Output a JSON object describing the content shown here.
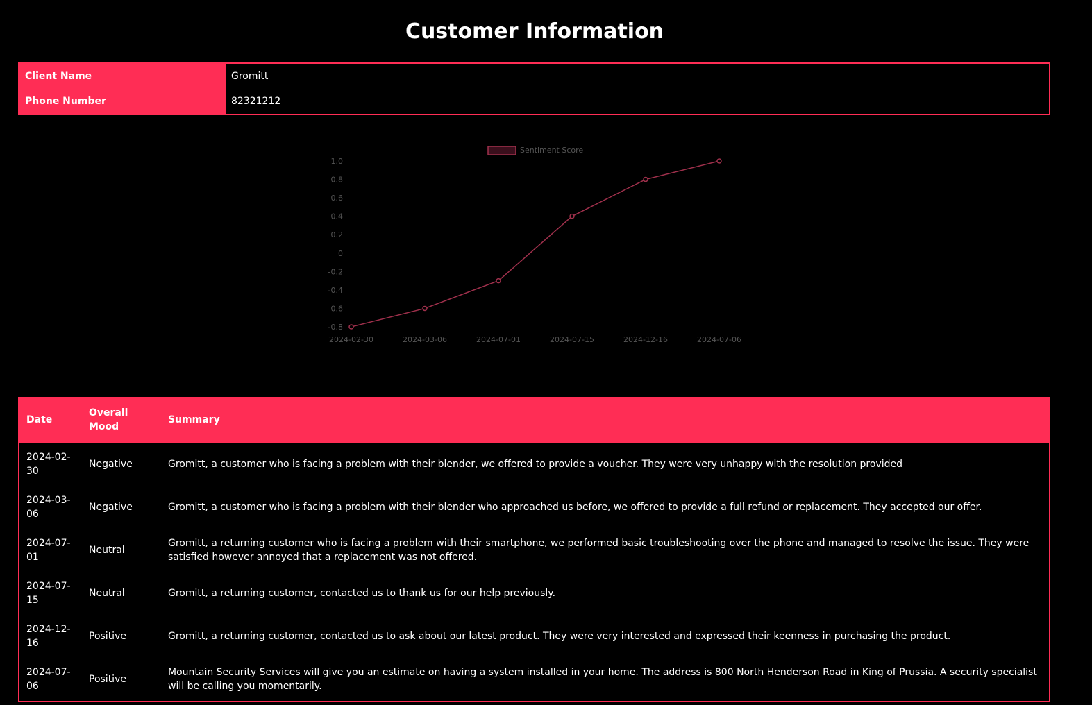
{
  "page": {
    "title": "Customer Information"
  },
  "customer": {
    "name_label": "Client Name",
    "name_value": "Gromitt",
    "phone_label": "Phone Number",
    "phone_value": "82321212"
  },
  "colors": {
    "accent": "#ff2d55",
    "line": "#a0304c",
    "axis_text": "#555555"
  },
  "chart_data": {
    "type": "line",
    "title": "",
    "xlabel": "",
    "ylabel": "",
    "categories": [
      "2024-02-30",
      "2024-03-06",
      "2024-07-01",
      "2024-07-15",
      "2024-12-16",
      "2024-07-06"
    ],
    "series": [
      {
        "name": "Sentiment Score",
        "values": [
          -0.8,
          -0.6,
          -0.3,
          0.4,
          0.8,
          1.0
        ]
      }
    ],
    "ylim": [
      -0.8,
      1.0
    ],
    "yticks": [
      "1.0",
      "0.8",
      "0.6",
      "0.4",
      "0.2",
      "0",
      "-0.2",
      "-0.4",
      "-0.6",
      "-0.8"
    ],
    "grid": false,
    "legend": "top"
  },
  "table": {
    "headers": {
      "date": "Date",
      "mood": "Overall Mood",
      "summary": "Summary"
    },
    "rows": [
      {
        "date": "2024-02-30",
        "mood": "Negative",
        "summary": "Gromitt, a customer who is facing a problem with their blender, we offered to provide a voucher. They were very unhappy with the resolution provided"
      },
      {
        "date": "2024-03-06",
        "mood": "Negative",
        "summary": "Gromitt, a customer who is facing a problem with their blender who approached us before, we offered to provide a full refund or replacement. They accepted our offer."
      },
      {
        "date": "2024-07-01",
        "mood": "Neutral",
        "summary": "Gromitt, a returning customer who is facing a problem with their smartphone, we performed basic troubleshooting over the phone and managed to resolve the issue. They were satisfied however annoyed that a replacement was not offered."
      },
      {
        "date": "2024-07-15",
        "mood": "Neutral",
        "summary": "Gromitt, a returning customer, contacted us to thank us for our help previously."
      },
      {
        "date": "2024-12-16",
        "mood": "Positive",
        "summary": "Gromitt, a returning customer, contacted us to ask about our latest product. They were very interested and expressed their keenness in purchasing the product."
      },
      {
        "date": "2024-07-06",
        "mood": "Positive",
        "summary": "Mountain Security Services will give you an estimate on having a system installed in your home. The address is 800 North Henderson Road in King of Prussia. A security specialist will be calling you momentarily."
      }
    ]
  }
}
